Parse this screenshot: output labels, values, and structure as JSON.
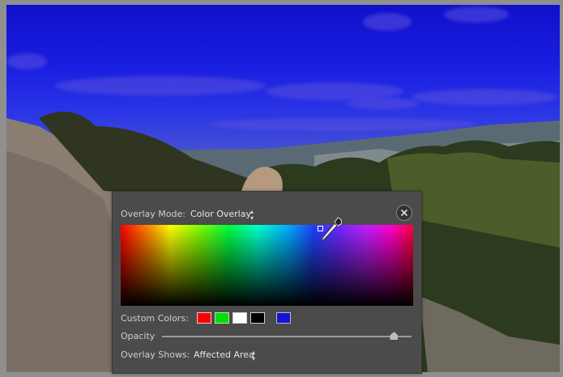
{
  "overlay_panel": {
    "mode_label": "Overlay Mode:",
    "mode_value": "Color Overlay",
    "custom_colors_label": "Custom Colors:",
    "custom_colors": [
      "#ff0000",
      "#00e000",
      "#ffffff",
      "#000000"
    ],
    "current_color": "#1414d8",
    "opacity_label": "Opacity",
    "opacity_value": 0.93,
    "shows_label": "Overlay Shows:",
    "shows_value": "Affected Area"
  },
  "icons": {
    "close": "close-icon",
    "eyedropper": "eyedropper-icon",
    "updown": "updown-chevron-icon"
  }
}
